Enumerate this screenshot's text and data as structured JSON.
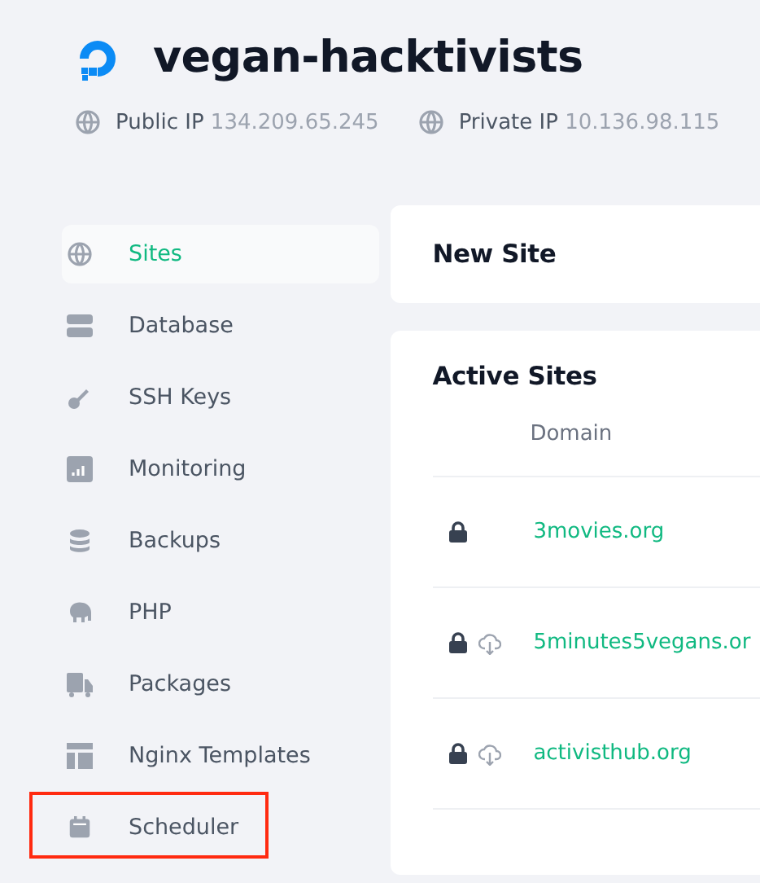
{
  "header": {
    "title": "vegan-hacktivists",
    "meta": [
      {
        "label": "Public IP",
        "value": "134.209.65.245"
      },
      {
        "label": "Private IP",
        "value": "10.136.98.115"
      }
    ]
  },
  "sidebar": {
    "items": [
      {
        "label": "Sites",
        "kind": "globe",
        "selected": true,
        "highlighted": false
      },
      {
        "label": "Database",
        "kind": "server",
        "selected": false,
        "highlighted": false
      },
      {
        "label": "SSH Keys",
        "kind": "key",
        "selected": false,
        "highlighted": false
      },
      {
        "label": "Monitoring",
        "kind": "chart",
        "selected": false,
        "highlighted": false
      },
      {
        "label": "Backups",
        "kind": "stack",
        "selected": false,
        "highlighted": false
      },
      {
        "label": "PHP",
        "kind": "elephant",
        "selected": false,
        "highlighted": false
      },
      {
        "label": "Packages",
        "kind": "truck",
        "selected": false,
        "highlighted": false
      },
      {
        "label": "Nginx Templates",
        "kind": "layout",
        "selected": false,
        "highlighted": false
      },
      {
        "label": "Scheduler",
        "kind": "calendar",
        "selected": false,
        "highlighted": true
      }
    ]
  },
  "new_site": {
    "title": "New Site"
  },
  "active_sites": {
    "title": "Active Sites",
    "columns": [
      "Domain"
    ],
    "rows": [
      {
        "domain": "3movies.org",
        "ssl": true,
        "backup": false
      },
      {
        "domain": "5minutes5vegans.or",
        "ssl": true,
        "backup": true
      },
      {
        "domain": "activisthub.org",
        "ssl": true,
        "backup": true
      }
    ]
  }
}
